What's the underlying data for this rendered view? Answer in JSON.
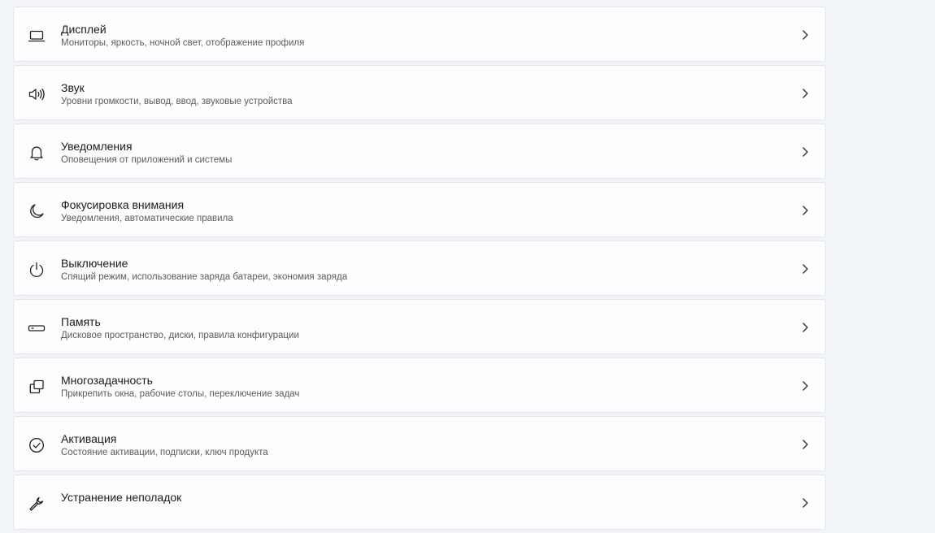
{
  "settings": {
    "items": [
      {
        "title": "Дисплей",
        "subtitle": "Мониторы, яркость, ночной свет, отображение профиля",
        "icon": "display-icon"
      },
      {
        "title": "Звук",
        "subtitle": "Уровни громкости, вывод, ввод, звуковые устройства",
        "icon": "speaker-icon"
      },
      {
        "title": "Уведомления",
        "subtitle": "Оповещения от приложений и системы",
        "icon": "bell-icon"
      },
      {
        "title": "Фокусировка внимания",
        "subtitle": "Уведомления, автоматические правила",
        "icon": "moon-icon"
      },
      {
        "title": "Выключение",
        "subtitle": "Спящий режим, использование заряда батареи, экономия заряда",
        "icon": "power-icon"
      },
      {
        "title": "Память",
        "subtitle": "Дисковое пространство, диски, правила конфигурации",
        "icon": "storage-icon"
      },
      {
        "title": "Многозадачность",
        "subtitle": "Прикрепить окна, рабочие столы, переключение задач",
        "icon": "multitasking-icon"
      },
      {
        "title": "Активация",
        "subtitle": "Состояние активации, подписки, ключ продукта",
        "icon": "checkmark-circle-icon"
      },
      {
        "title": "Устранение неполадок",
        "subtitle": "",
        "icon": "wrench-icon"
      }
    ]
  },
  "colors": {
    "background": "#f1f4f9",
    "card": "#fdfdff",
    "border": "#e5e7ea",
    "title": "#1b1b1b",
    "subtitle": "#5c5c5c"
  }
}
